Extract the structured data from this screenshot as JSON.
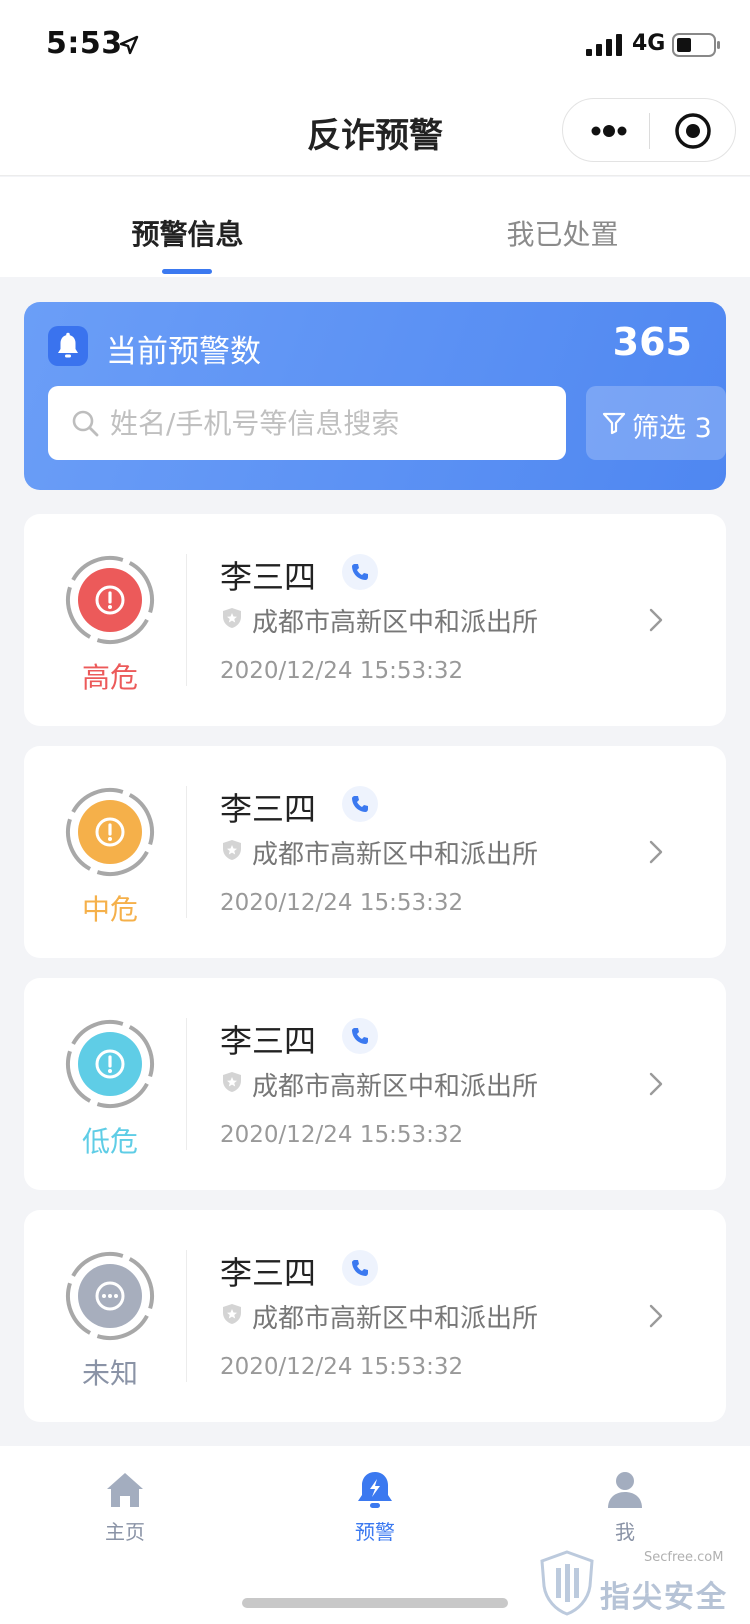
{
  "status_bar": {
    "time": "5:53",
    "network": "4G",
    "icons": [
      "location-arrow-icon",
      "signal-bars-icon",
      "battery-icon"
    ]
  },
  "nav": {
    "title": "反诈预警",
    "icons": [
      "more-dots-icon",
      "close-target-icon"
    ]
  },
  "tabs": [
    {
      "label": "预警信息",
      "active": true
    },
    {
      "label": "我已处置",
      "active": false
    }
  ],
  "summary": {
    "label": "当前预警数",
    "count": "365",
    "icon": "bell-icon",
    "search_placeholder": "姓名/手机号等信息搜索",
    "search_value": "",
    "filter_label": "筛选 3"
  },
  "alerts": [
    {
      "risk": "高危",
      "color": "#ec5a5a",
      "icon": "exclamation-icon",
      "name": "李三四",
      "org": "成都市高新区中和派出所",
      "time": "2020/12/24 15:53:32"
    },
    {
      "risk": "中危",
      "color": "#f5b04a",
      "icon": "exclamation-icon",
      "name": "李三四",
      "org": "成都市高新区中和派出所",
      "time": "2020/12/24 15:53:32"
    },
    {
      "risk": "低危",
      "color": "#5fcde6",
      "icon": "exclamation-icon",
      "name": "李三四",
      "org": "成都市高新区中和派出所",
      "time": "2020/12/24 15:53:32"
    },
    {
      "risk": "未知",
      "color": "#a7aebd",
      "icon": "ellipsis-icon",
      "name": "李三四",
      "org": "成都市高新区中和派出所",
      "time": "2020/12/24 15:53:32"
    }
  ],
  "tabbar": [
    {
      "label": "主页",
      "icon": "home-icon",
      "active": false
    },
    {
      "label": "预警",
      "icon": "alarm-bell-icon",
      "active": true
    },
    {
      "label": "我",
      "icon": "user-icon",
      "active": false
    }
  ],
  "watermark": {
    "url": "Secfree.coM",
    "name": "指尖安全"
  },
  "colors": {
    "primary": "#3b79f0",
    "summary_gradient_start": "#6b9ef7",
    "summary_gradient_end": "#4f87f1"
  }
}
